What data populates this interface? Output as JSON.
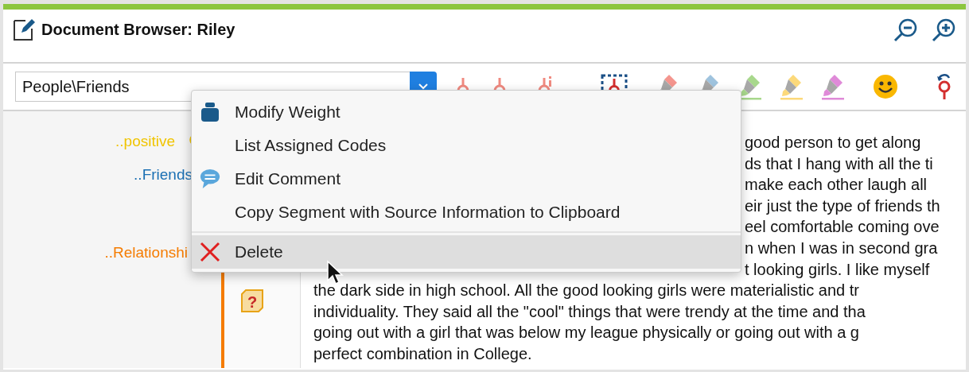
{
  "window": {
    "title": "Document Browser: Riley"
  },
  "code_field": {
    "value": "People\\Friends"
  },
  "highlighters": [
    {
      "color": "#f4958e"
    },
    {
      "color": "#9fc3de"
    },
    {
      "color": "#a8d88c"
    },
    {
      "color": "#fcd97a"
    },
    {
      "color": "#df8ad8"
    }
  ],
  "code_labels": [
    {
      "text": "..positive",
      "color": "#f0c400"
    },
    {
      "text": "..Friends",
      "color": "#1a6fb3"
    },
    {
      "text": "..Relationshi",
      "color": "#f57c00"
    }
  ],
  "memo": {
    "symbol": "?"
  },
  "context_menu": [
    {
      "label": "Modify Weight",
      "kind": "weight",
      "selected": false
    },
    {
      "label": "List Assigned Codes",
      "kind": "plain",
      "selected": false
    },
    {
      "label": "Edit Comment",
      "kind": "comment",
      "selected": false
    },
    {
      "label": "Copy Segment with Source Information to Clipboard",
      "kind": "plain",
      "selected": false
    },
    {
      "label": "Delete",
      "kind": "delete",
      "selected": true
    }
  ],
  "document_lines": [
    {
      "text": "good person to get along",
      "kind": "fragment"
    },
    {
      "text": "ds that I hang with all the ti",
      "kind": "fragment"
    },
    {
      "text": "make each other laugh all",
      "kind": "fragment"
    },
    {
      "text": "eir just the type of friends th",
      "kind": "fragment"
    },
    {
      "text": "eel comfortable coming ove",
      "kind": "fragment"
    },
    {
      "text": "n when I was in second gra",
      "kind": "fragment"
    },
    {
      "text": "t looking girls. I like myself",
      "kind": "fragment"
    },
    {
      "text": "the dark side in high school. All the good looking girls were materialistic and tr",
      "kind": "full"
    },
    {
      "text": "individuality. They said all the \"cool\" things that were trendy at the time and tha",
      "kind": "full"
    },
    {
      "text": "going out with a girl that was below my league physically or going out with a g",
      "kind": "full"
    },
    {
      "text": "perfect combination in College.",
      "kind": "full"
    }
  ]
}
